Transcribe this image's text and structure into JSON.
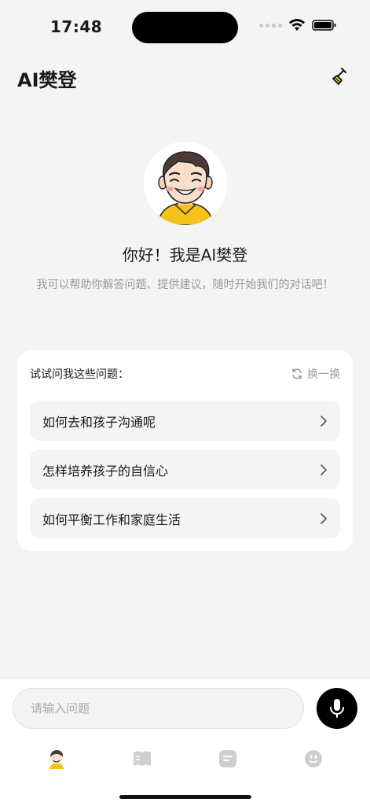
{
  "status_bar": {
    "time": "17:48"
  },
  "header": {
    "title": "AI樊登"
  },
  "hero": {
    "greeting": "你好！我是AI樊登",
    "subtitle": "我可以帮助你解答问题、提供建议，随时开始我们的对话吧！"
  },
  "suggestions": {
    "title": "试试问我这些问题：",
    "refresh_label": "换一换",
    "questions": [
      {
        "text": "如何去和孩子沟通呢"
      },
      {
        "text": "怎样培养孩子的自信心"
      },
      {
        "text": "如何平衡工作和家庭生活"
      }
    ]
  },
  "input": {
    "placeholder": "请输入问题",
    "value": ""
  },
  "tabs": [
    {
      "icon": "avatar-icon",
      "active": true
    },
    {
      "icon": "book-icon",
      "active": false
    },
    {
      "icon": "note-icon",
      "active": false
    },
    {
      "icon": "smiley-icon",
      "active": false
    }
  ],
  "colors": {
    "background": "#f4f4f5",
    "card": "#ffffff",
    "primary_text": "#1a1a1a",
    "muted_text": "#9a9a9a",
    "accent_yellow": "#f4c21a",
    "mic_button": "#000000",
    "inactive_tab": "#cfcfcf"
  }
}
